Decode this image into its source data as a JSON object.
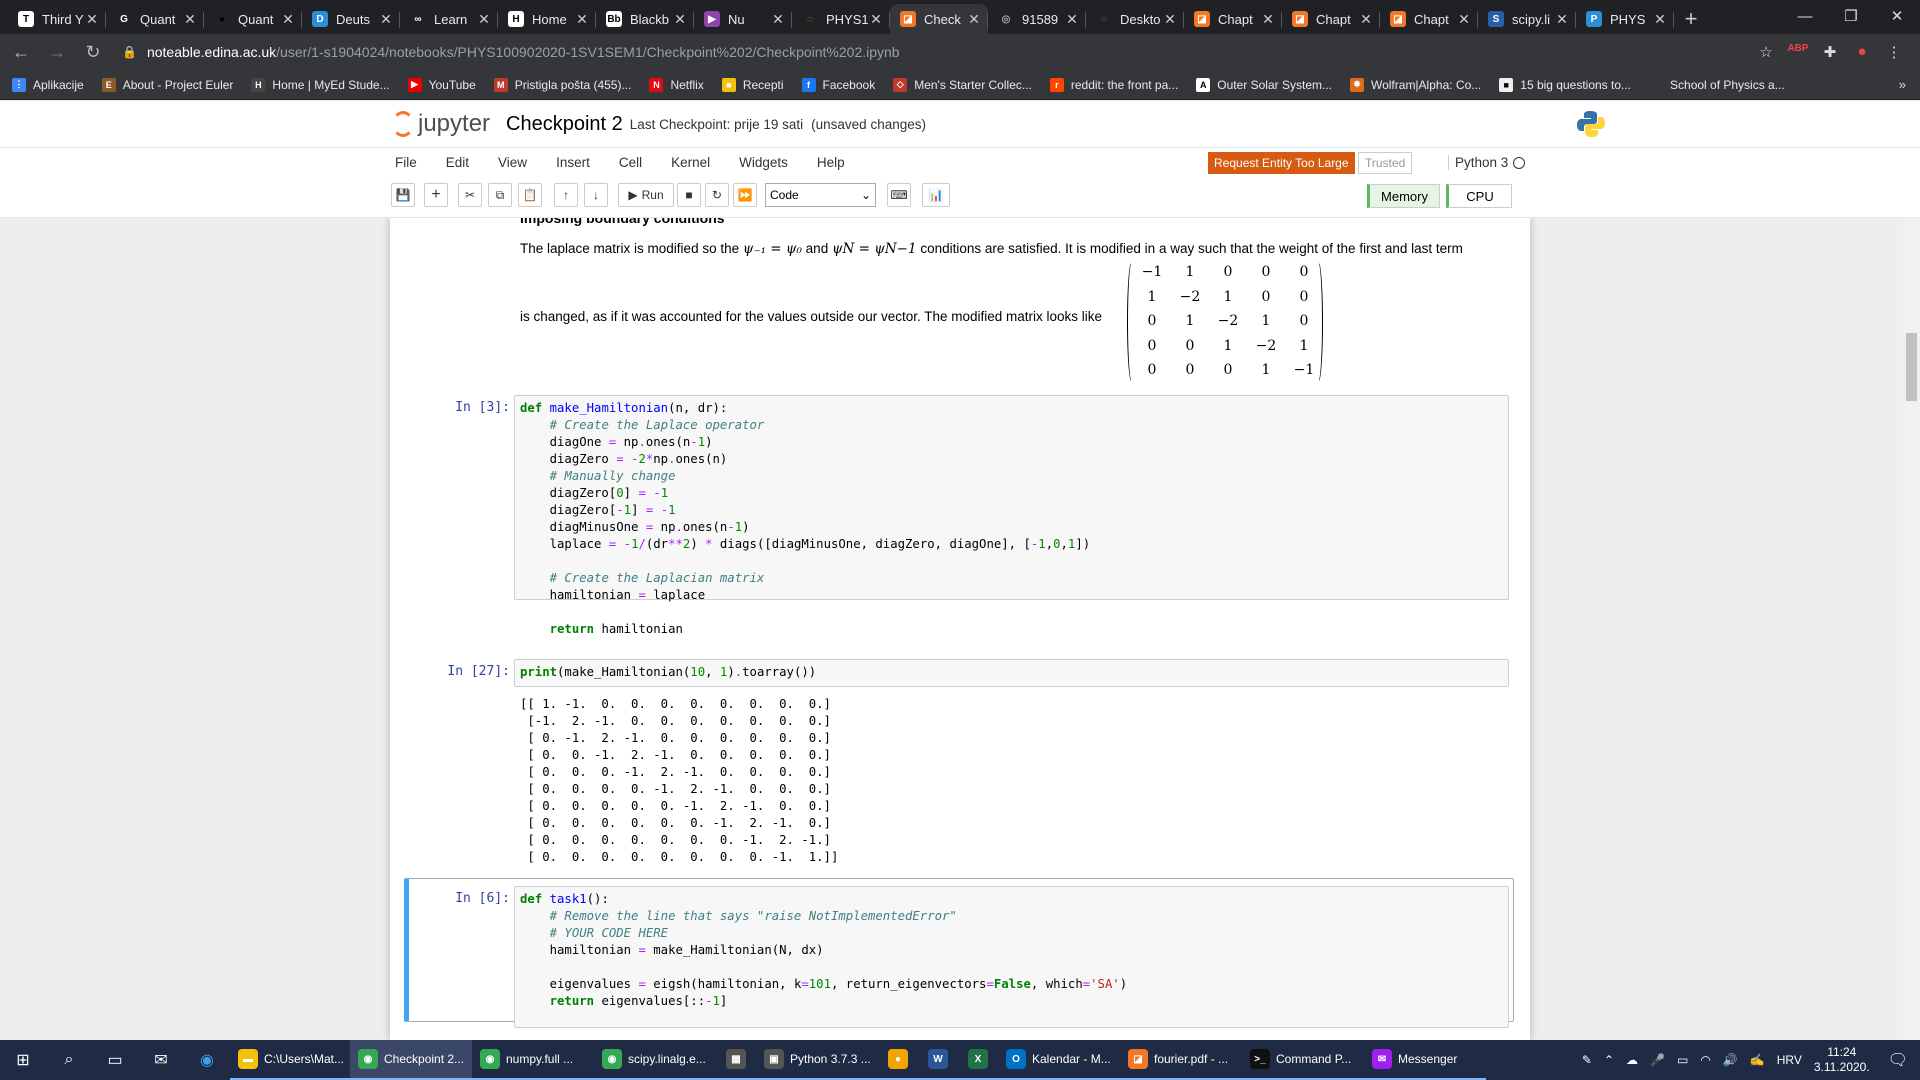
{
  "browser": {
    "tabs": [
      {
        "title": "Third Y",
        "icon": "T",
        "color": "#fff",
        "fg": "#000",
        "active": false
      },
      {
        "title": "Quant",
        "icon": "G",
        "color": "#202124",
        "fg": "#fff",
        "active": false
      },
      {
        "title": "Quant",
        "icon": "●",
        "color": "#202124",
        "fg": "#000",
        "active": false
      },
      {
        "title": "Deuts",
        "icon": "D",
        "color": "#2a8fd6",
        "fg": "#fff",
        "active": false
      },
      {
        "title": "Learn",
        "icon": "∞",
        "color": "#202124",
        "fg": "#fff",
        "active": false
      },
      {
        "title": "Home",
        "icon": "H",
        "color": "#fff",
        "fg": "#000",
        "active": false
      },
      {
        "title": "Blackb",
        "icon": "Bb",
        "color": "#fff",
        "fg": "#000",
        "active": false
      },
      {
        "title": "Nu",
        "icon": "▶",
        "color": "#8e44ad",
        "fg": "#fff",
        "active": false
      },
      {
        "title": "PHYS1",
        "icon": "◌",
        "color": "#202124",
        "fg": "#f37726",
        "active": false
      },
      {
        "title": "Check",
        "icon": "◪",
        "color": "#f37726",
        "fg": "#fff",
        "active": true
      },
      {
        "title": "91589",
        "icon": "◎",
        "color": "#202124",
        "fg": "#aaa",
        "active": false
      },
      {
        "title": "Deskto",
        "icon": "◌",
        "color": "#202124",
        "fg": "#f37726",
        "active": false
      },
      {
        "title": "Chapt",
        "icon": "◪",
        "color": "#f37726",
        "fg": "#fff",
        "active": false
      },
      {
        "title": "Chapt",
        "icon": "◪",
        "color": "#f37726",
        "fg": "#fff",
        "active": false
      },
      {
        "title": "Chapt",
        "icon": "◪",
        "color": "#f37726",
        "fg": "#fff",
        "active": false
      },
      {
        "title": "scipy.li",
        "icon": "S",
        "color": "#2a5ea8",
        "fg": "#fff",
        "active": false
      },
      {
        "title": "PHYS",
        "icon": "P",
        "color": "#2a8fd6",
        "fg": "#fff",
        "active": false
      }
    ],
    "url_domain": "noteable.edina.ac.uk",
    "url_path": "/user/1-s1904024/notebooks/PHYS100902020-1SV1SEM1/Checkpoint%202/Checkpoint%202.ipynb",
    "bookmarks": [
      {
        "label": "Aplikacije",
        "icon": "⋮",
        "color": "#4285f4"
      },
      {
        "label": "About - Project Euler",
        "icon": "E",
        "color": "#8b5a2b"
      },
      {
        "label": "Home | MyEd Stude...",
        "icon": "H",
        "color": "#444"
      },
      {
        "label": "YouTube",
        "icon": "▶",
        "color": "#e00"
      },
      {
        "label": "Pristigla pošta (455)...",
        "icon": "M",
        "color": "#c0392b"
      },
      {
        "label": "Netflix",
        "icon": "N",
        "color": "#e50914"
      },
      {
        "label": "Recepti",
        "icon": "■",
        "color": "#f4c20d"
      },
      {
        "label": "Facebook",
        "icon": "f",
        "color": "#1877f2"
      },
      {
        "label": "Men's Starter Collec...",
        "icon": "◇",
        "color": "#c0392b"
      },
      {
        "label": "reddit: the front pa...",
        "icon": "r",
        "color": "#ff4500"
      },
      {
        "label": "Outer Solar System...",
        "icon": "A",
        "color": "#fff"
      },
      {
        "label": "Wolfram|Alpha: Co...",
        "icon": "✸",
        "color": "#dd6b1a"
      },
      {
        "label": "15 big questions to...",
        "icon": "■",
        "color": "#eee"
      },
      {
        "label": "School of Physics a...",
        "icon": "",
        "color": "#35363a"
      }
    ]
  },
  "jupyter": {
    "logo_text": "jupyter",
    "notebook_title": "Checkpoint 2",
    "checkpoint": "Last Checkpoint: prije 19 sati",
    "unsaved": "(unsaved changes)",
    "menus": [
      "File",
      "Edit",
      "View",
      "Insert",
      "Cell",
      "Kernel",
      "Widgets",
      "Help"
    ],
    "error_badge": "Request Entity Too Large",
    "trusted": "Trusted",
    "kernel": "Python 3",
    "run_label": "Run",
    "cell_type": "Code",
    "memory": "Memory",
    "cpu": "CPU"
  },
  "notebook": {
    "heading_partial": "Imposing boundary conditions",
    "md_line1_a": "The laplace matrix is modified so the",
    "md_line1_b": "and",
    "md_line1_c": "conditions are satisfied. It is modified in a way such that the weight of the first and last term",
    "md_math1": "ψ₋₁ = ψ₀",
    "md_math2": "ψN = ψN−1",
    "md_line2": "is changed, as if it was accounted for the values outside our vector. The modified matrix looks like",
    "matrix": [
      [
        "−1",
        "1",
        "0",
        "0",
        "0"
      ],
      [
        "1",
        "−2",
        "1",
        "0",
        "0"
      ],
      [
        "0",
        "1",
        "−2",
        "1",
        "0"
      ],
      [
        "0",
        "0",
        "1",
        "−2",
        "1"
      ],
      [
        "0",
        "0",
        "0",
        "1",
        "−1"
      ]
    ],
    "cell1_prompt": "In [3]:",
    "cell2_prompt": "In [27]:",
    "cell3_prompt": "In [6]:",
    "cell2_code": "print(make_Hamiltonian(10, 1).toarray())",
    "cell2_output": "[[ 1. -1.  0.  0.  0.  0.  0.  0.  0.  0.]\n [-1.  2. -1.  0.  0.  0.  0.  0.  0.  0.]\n [ 0. -1.  2. -1.  0.  0.  0.  0.  0.  0.]\n [ 0.  0. -1.  2. -1.  0.  0.  0.  0.  0.]\n [ 0.  0.  0. -1.  2. -1.  0.  0.  0.  0.]\n [ 0.  0.  0.  0. -1.  2. -1.  0.  0.  0.]\n [ 0.  0.  0.  0.  0. -1.  2. -1.  0.  0.]\n [ 0.  0.  0.  0.  0.  0. -1.  2. -1.  0.]\n [ 0.  0.  0.  0.  0.  0.  0. -1.  2. -1.]\n [ 0.  0.  0.  0.  0.  0.  0.  0. -1.  1.]]"
  },
  "taskbar": {
    "apps": [
      {
        "label": "C:\\Users\\Mat...",
        "icon": "▬",
        "color": "#f4c20d",
        "w": 120
      },
      {
        "label": "Checkpoint 2...",
        "icon": "◉",
        "color": "#34a853",
        "w": 122
      },
      {
        "label": "numpy.full ...",
        "icon": "◉",
        "color": "#34a853",
        "w": 122
      },
      {
        "label": "scipy.linalg.e...",
        "icon": "◉",
        "color": "#34a853",
        "w": 122
      },
      {
        "label": "",
        "icon": "▦",
        "color": "#555",
        "w": 40
      },
      {
        "label": "Python 3.7.3 ...",
        "icon": "▣",
        "color": "#555",
        "w": 122
      },
      {
        "label": "",
        "icon": "●",
        "color": "#f4a400",
        "w": 40
      },
      {
        "label": "",
        "icon": "W",
        "color": "#2b579a",
        "w": 40
      },
      {
        "label": "",
        "icon": "X",
        "color": "#217346",
        "w": 40
      },
      {
        "label": "Kalendar - M...",
        "icon": "O",
        "color": "#0072c6",
        "w": 122
      },
      {
        "label": "fourier.pdf - ...",
        "icon": "◪",
        "color": "#f37726",
        "w": 122
      },
      {
        "label": "Command P...",
        "icon": ">_",
        "color": "#111",
        "w": 122
      },
      {
        "label": "Messenger",
        "icon": "✉",
        "color": "#a020f0",
        "w": 122
      }
    ],
    "lang": "HRV",
    "time": "11:24",
    "date": "3.11.2020."
  }
}
